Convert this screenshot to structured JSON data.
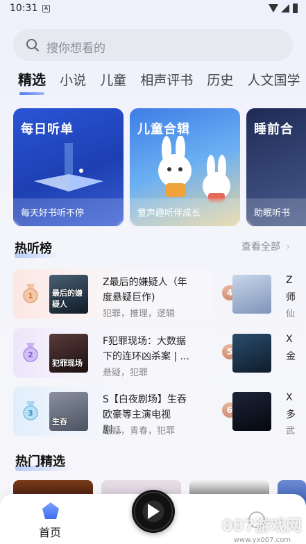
{
  "status_bar": {
    "time": "10:31",
    "notification_glyph": "A"
  },
  "search": {
    "placeholder": "搜你想看的"
  },
  "tabs": [
    {
      "label": "精选",
      "active": true
    },
    {
      "label": "小说"
    },
    {
      "label": "儿童"
    },
    {
      "label": "相声评书"
    },
    {
      "label": "历史"
    },
    {
      "label": "人文国学"
    }
  ],
  "banners": [
    {
      "title": "每日听单",
      "subtitle": "每天好书听不停"
    },
    {
      "title": "儿童合辑",
      "subtitle": "童声趣听伴成长"
    },
    {
      "title": "睡前合",
      "subtitle": "助眠听书"
    }
  ],
  "hot_list": {
    "title": "热听榜",
    "see_all": "查看全部",
    "left": [
      {
        "rank": "1",
        "title": "Z最后的嫌疑人（年度悬疑巨作)",
        "tags": "犯罪，推理，逻辑",
        "cover_text": "最后的嫌疑人",
        "cover_color": "#1c2a3a"
      },
      {
        "rank": "2",
        "title": "F犯罪现场：大数据下的连环凶杀案 | ...",
        "tags": "悬疑，犯罪",
        "cover_text": "犯罪现场",
        "cover_color": "#2a1e1e"
      },
      {
        "rank": "3",
        "title": "S【白夜剧场】生吞欧豪等主演电视剧...",
        "tags": "悬疑，青春，犯罪",
        "cover_text": "生吞",
        "cover_color": "#6a7080"
      }
    ],
    "right": [
      {
        "rank": "4",
        "t1": "Z",
        "t2": "师",
        "t3": "仙",
        "cover_color": "#9fb6d6"
      },
      {
        "rank": "5",
        "t1": "X",
        "t2": "金",
        "t3": "",
        "cover_color": "#203850"
      },
      {
        "rank": "6",
        "t1": "X",
        "t2": "多",
        "t3": "武",
        "cover_color": "#0e1524"
      }
    ]
  },
  "hot_picks": {
    "title": "热门精选"
  },
  "bottom_nav": {
    "home_label": "首页"
  },
  "watermark": {
    "text": "007游戏网",
    "sub": "www.yx007.com"
  },
  "colors": {
    "accent": "#4a7cf2",
    "rank_bronze": "#d9997e"
  }
}
